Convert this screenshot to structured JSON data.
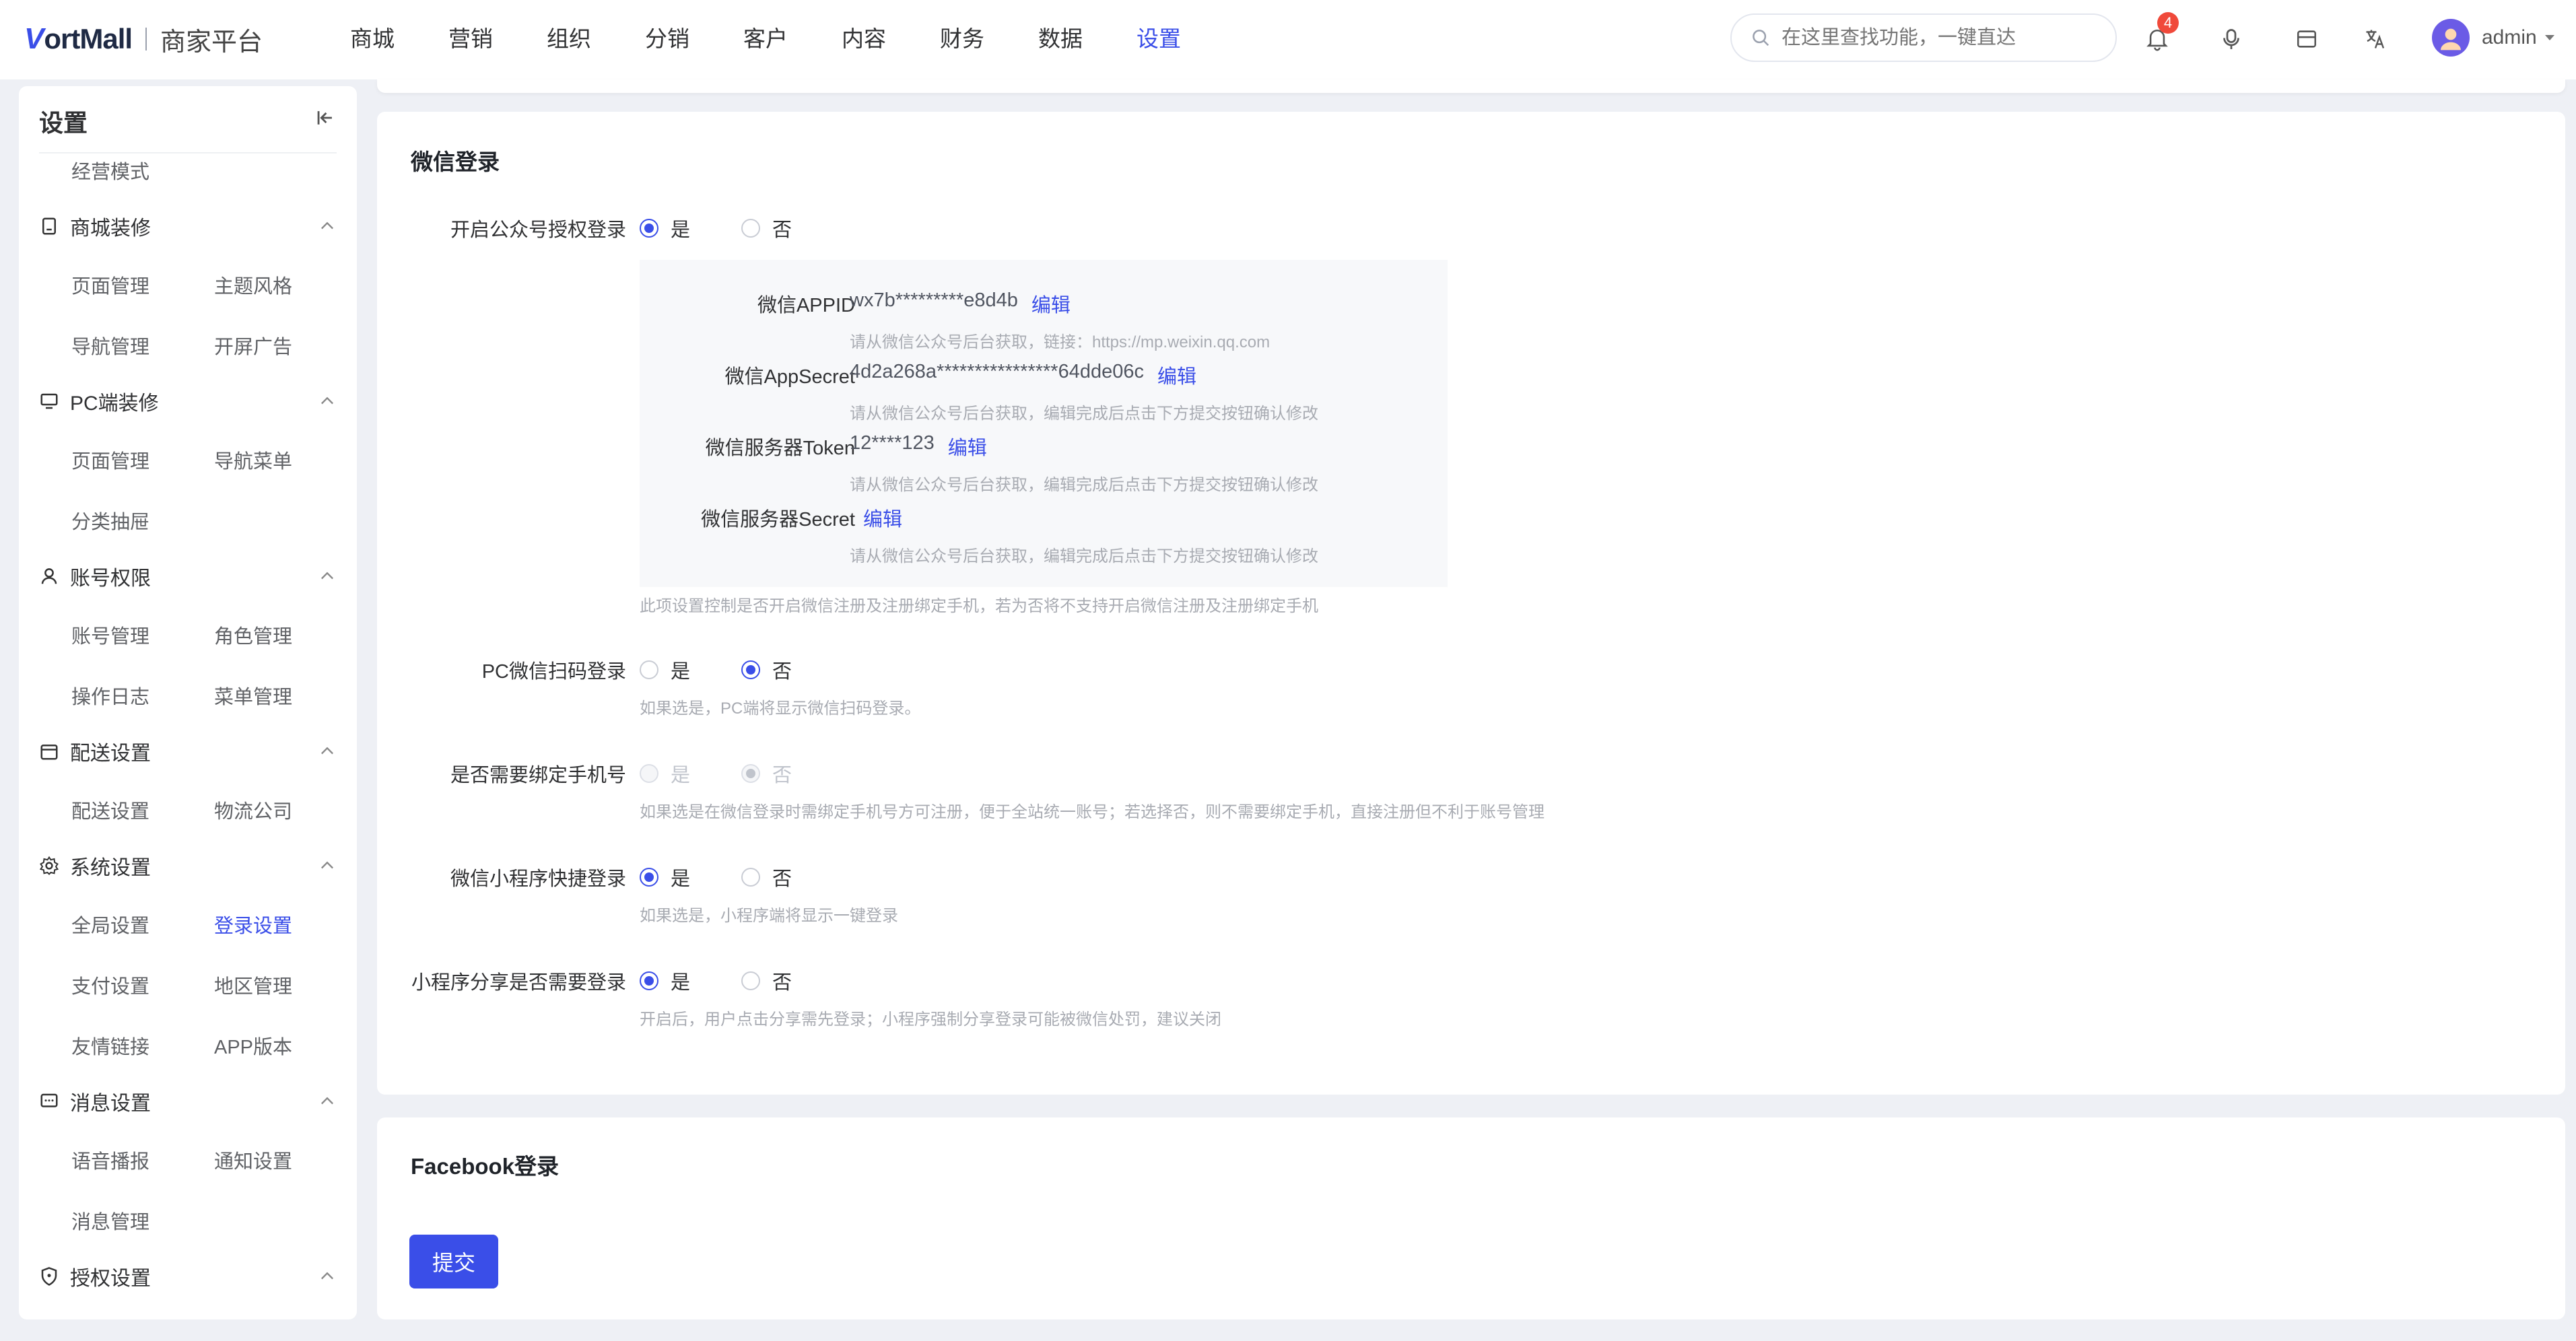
{
  "brand": {
    "name": "ortMall",
    "subtitle": "商家平台"
  },
  "topnav": [
    "商城",
    "营销",
    "组织",
    "分销",
    "客户",
    "内容",
    "财务",
    "数据",
    "设置"
  ],
  "topnav_active": "设置",
  "search": {
    "placeholder": "在这里查找功能，一键直达"
  },
  "notifications": {
    "count": "4"
  },
  "user": {
    "name": "admin"
  },
  "sidebar": {
    "title": "设置",
    "partial_top": "经营模式",
    "groups": [
      {
        "title": "商城装修",
        "icon": "clipboard-icon",
        "links": [
          "页面管理",
          "主题风格",
          "导航管理",
          "开屏广告"
        ]
      },
      {
        "title": "PC端装修",
        "icon": "monitor-icon",
        "links": [
          "页面管理",
          "导航菜单",
          "分类抽屉"
        ]
      },
      {
        "title": "账号权限",
        "icon": "user-icon",
        "links": [
          "账号管理",
          "角色管理",
          "操作日志",
          "菜单管理"
        ]
      },
      {
        "title": "配送设置",
        "icon": "calendar-icon",
        "links": [
          "配送设置",
          "物流公司"
        ]
      },
      {
        "title": "系统设置",
        "icon": "gear-icon",
        "links": [
          "全局设置",
          "登录设置",
          "支付设置",
          "地区管理",
          "友情链接",
          "APP版本"
        ]
      },
      {
        "title": "消息设置",
        "icon": "message-icon",
        "links": [
          "语音播报",
          "通知设置",
          "消息管理"
        ]
      },
      {
        "title": "授权设置",
        "icon": "shield-icon",
        "links": []
      }
    ],
    "active_link": "登录设置"
  },
  "wechat": {
    "title": "微信登录",
    "oauth": {
      "label": "开启公众号授权登录",
      "yes": "是",
      "no": "否",
      "selected": "是"
    },
    "appid": {
      "label": "微信APPID",
      "value": "wx7b*********e8d4b",
      "edit": "编辑",
      "hint": "请从微信公众号后台获取，链接：https://mp.weixin.qq.com"
    },
    "appsecret": {
      "label": "微信AppSecret",
      "value": "4d2a268a****************64dde06c",
      "edit": "编辑",
      "hint": "请从微信公众号后台获取，编辑完成后点击下方提交按钮确认修改"
    },
    "token": {
      "label": "微信服务器Token",
      "value": "12****123",
      "edit": "编辑",
      "hint": "请从微信公众号后台获取，编辑完成后点击下方提交按钮确认修改"
    },
    "server_secret": {
      "label": "微信服务器Secret",
      "value": "",
      "edit": "编辑",
      "hint": "请从微信公众号后台获取，编辑完成后点击下方提交按钮确认修改"
    },
    "oauth_hint": "此项设置控制是否开启微信注册及注册绑定手机，若为否将不支持开启微信注册及注册绑定手机",
    "pc_scan": {
      "label": "PC微信扫码登录",
      "yes": "是",
      "no": "否",
      "selected": "否",
      "hint": "如果选是，PC端将显示微信扫码登录。"
    },
    "bind_phone": {
      "label": "是否需要绑定手机号",
      "yes": "是",
      "no": "否",
      "selected": "否",
      "disabled": true,
      "hint": "如果选是在微信登录时需绑定手机号方可注册，便于全站统一账号；若选择否，则不需要绑定手机，直接注册但不利于账号管理"
    },
    "mini_quick": {
      "label": "微信小程序快捷登录",
      "yes": "是",
      "no": "否",
      "selected": "是",
      "hint": "如果选是，小程序端将显示一键登录"
    },
    "mini_share": {
      "label": "小程序分享是否需要登录",
      "yes": "是",
      "no": "否",
      "selected": "是",
      "hint": "开启后，用户点击分享需先登录；小程序强制分享登录可能被微信处罚，建议关闭"
    }
  },
  "facebook": {
    "title": "Facebook登录"
  },
  "submit_label": "提交",
  "colors": {
    "accent": "#3a4ee8",
    "badge": "#f0493a"
  }
}
